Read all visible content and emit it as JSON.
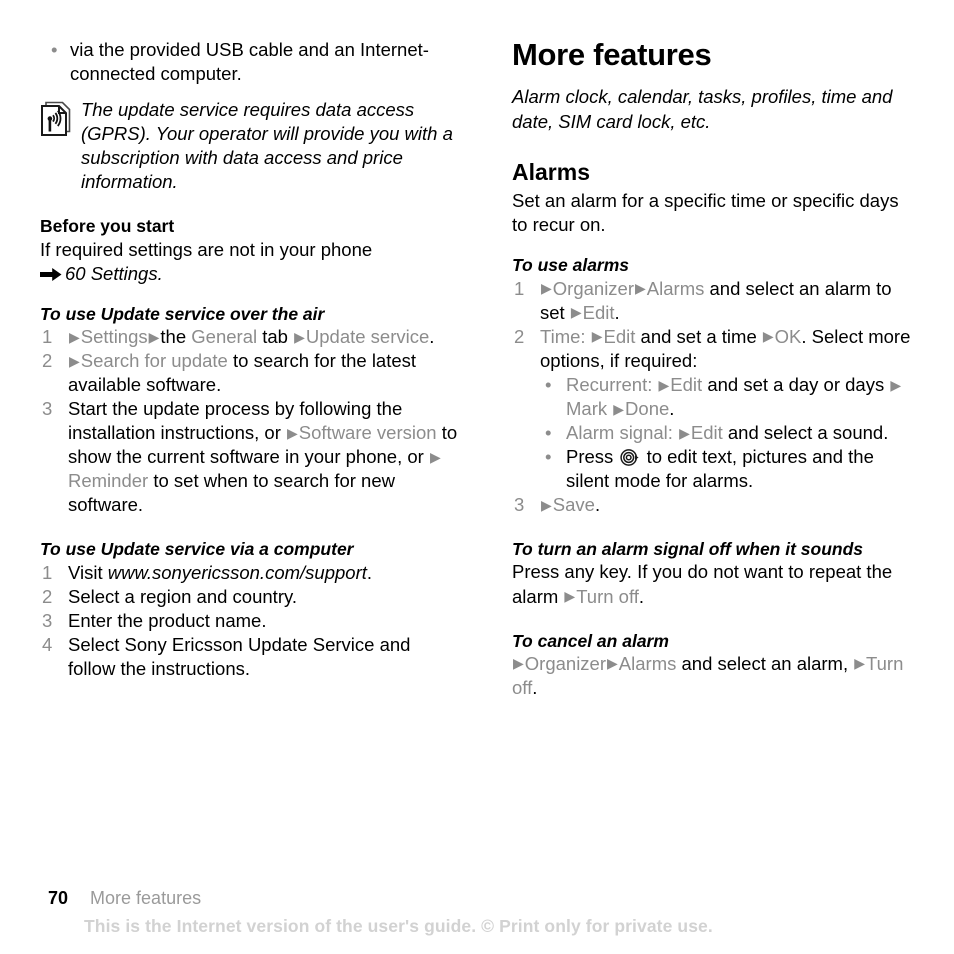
{
  "document": {
    "type": "user-guide-page",
    "page_number": "70",
    "chapter": "More features",
    "watermark": "This is the Internet version of the user's guide. © Print only for private use."
  },
  "left_column": {
    "continued_bullets": [
      "via the provided USB cable and an Internet-connected computer."
    ],
    "note": {
      "icon": "antenna-note-icon",
      "text": "The update service requires data access (GPRS). Your operator will provide you with a subscription with data access and price information."
    },
    "section_before_you_start": {
      "heading": "Before you start",
      "body_plain": "If required settings are not in your phone",
      "cross_reference": "60 Settings."
    },
    "section_ota": {
      "heading": "To use Update service over the air",
      "steps": [
        {
          "num": "1",
          "parts": [
            {
              "t": "tri"
            },
            {
              "t": "gray",
              "v": "Settings"
            },
            {
              "t": "tri"
            },
            {
              "t": "black",
              "v": "the "
            },
            {
              "t": "gray",
              "v": "General"
            },
            {
              "t": "black",
              "v": " tab "
            },
            {
              "t": "tri"
            },
            {
              "t": "gray",
              "v": "Update service"
            },
            {
              "t": "black",
              "v": "."
            }
          ]
        },
        {
          "num": "2",
          "parts": [
            {
              "t": "tri"
            },
            {
              "t": "gray",
              "v": "Search for update"
            },
            {
              "t": "black",
              "v": " to search for the latest available software."
            }
          ]
        },
        {
          "num": "3",
          "parts": [
            {
              "t": "black",
              "v": "Start the update process by following the installation instructions, or "
            },
            {
              "t": "tri"
            },
            {
              "t": "gray",
              "v": "Software version"
            },
            {
              "t": "black",
              "v": " to show the current software in your phone, or "
            },
            {
              "t": "tri"
            },
            {
              "t": "gray",
              "v": "Reminder"
            },
            {
              "t": "black",
              "v": " to set when to search for new software."
            }
          ]
        }
      ]
    },
    "section_computer": {
      "heading": "To use Update service via a computer",
      "steps": [
        {
          "num": "1",
          "parts": [
            {
              "t": "black",
              "v": "Visit "
            },
            {
              "t": "italic",
              "v": "www.sonyericsson.com/support"
            },
            {
              "t": "black",
              "v": "."
            }
          ]
        },
        {
          "num": "2",
          "parts": [
            {
              "t": "black",
              "v": "Select a region and country."
            }
          ]
        },
        {
          "num": "3",
          "parts": [
            {
              "t": "black",
              "v": "Enter the product name."
            }
          ]
        },
        {
          "num": "4",
          "parts": [
            {
              "t": "black",
              "v": "Select Sony Ericsson Update Service and follow the instructions."
            }
          ]
        }
      ]
    }
  },
  "right_column": {
    "chapter_title": "More features",
    "chapter_subtitle": "Alarm clock, calendar, tasks, profiles, time and date, SIM card lock, etc.",
    "section_alarms": {
      "heading": "Alarms",
      "intro": "Set an alarm for a specific time or specific days to recur on."
    },
    "section_to_use_alarms": {
      "heading": "To use alarms",
      "steps": [
        {
          "num": "1",
          "parts": [
            {
              "t": "tri"
            },
            {
              "t": "gray",
              "v": "Organizer"
            },
            {
              "t": "tri"
            },
            {
              "t": "gray",
              "v": "Alarms"
            },
            {
              "t": "black",
              "v": " and select an alarm to set "
            },
            {
              "t": "tri"
            },
            {
              "t": "gray",
              "v": "Edit"
            },
            {
              "t": "black",
              "v": "."
            }
          ]
        },
        {
          "num": "2",
          "parts": [
            {
              "t": "gray",
              "v": "Time:"
            },
            {
              "t": "black",
              "v": " "
            },
            {
              "t": "tri"
            },
            {
              "t": "gray",
              "v": "Edit"
            },
            {
              "t": "black",
              "v": " and set a time "
            },
            {
              "t": "tri"
            },
            {
              "t": "gray",
              "v": "OK"
            },
            {
              "t": "black",
              "v": ". Select more options, if required:"
            }
          ],
          "sub_bullets": [
            {
              "parts": [
                {
                  "t": "gray",
                  "v": "Recurrent:"
                },
                {
                  "t": "black",
                  "v": " "
                },
                {
                  "t": "tri"
                },
                {
                  "t": "gray",
                  "v": "Edit"
                },
                {
                  "t": "black",
                  "v": " and set a day or days "
                },
                {
                  "t": "tri"
                },
                {
                  "t": "gray",
                  "v": "Mark"
                },
                {
                  "t": "black",
                  "v": " "
                },
                {
                  "t": "tri"
                },
                {
                  "t": "gray",
                  "v": "Done"
                },
                {
                  "t": "black",
                  "v": "."
                }
              ]
            },
            {
              "parts": [
                {
                  "t": "gray",
                  "v": "Alarm signal:"
                },
                {
                  "t": "black",
                  "v": " "
                },
                {
                  "t": "tri"
                },
                {
                  "t": "gray",
                  "v": "Edit"
                },
                {
                  "t": "black",
                  "v": " and select a sound."
                }
              ]
            },
            {
              "parts": [
                {
                  "t": "black",
                  "v": "Press "
                },
                {
                  "t": "joystick"
                },
                {
                  "t": "black",
                  "v": " to edit text, pictures and the silent mode for alarms."
                }
              ]
            }
          ]
        },
        {
          "num": "3",
          "parts": [
            {
              "t": "tri"
            },
            {
              "t": "gray",
              "v": "Save"
            },
            {
              "t": "black",
              "v": "."
            }
          ]
        }
      ]
    },
    "section_turn_off": {
      "heading": "To turn an alarm signal off when it sounds",
      "parts": [
        {
          "t": "black",
          "v": "Press any key. If you do not want to repeat the alarm "
        },
        {
          "t": "tri"
        },
        {
          "t": "gray",
          "v": "Turn off"
        },
        {
          "t": "black",
          "v": "."
        }
      ]
    },
    "section_cancel": {
      "heading": "To cancel an alarm",
      "parts": [
        {
          "t": "tri"
        },
        {
          "t": "gray",
          "v": "Organizer"
        },
        {
          "t": "tri"
        },
        {
          "t": "gray",
          "v": "Alarms"
        },
        {
          "t": "black",
          "v": " and select an alarm, "
        },
        {
          "t": "tri"
        },
        {
          "t": "gray",
          "v": "Turn off"
        },
        {
          "t": "black",
          "v": "."
        }
      ]
    }
  },
  "colors": {
    "text": "#000000",
    "softkey_gray": "#8c8c8c",
    "watermark_gray": "#d2d2d2",
    "footer_gray": "#9a9a9a",
    "background": "#ffffff"
  }
}
